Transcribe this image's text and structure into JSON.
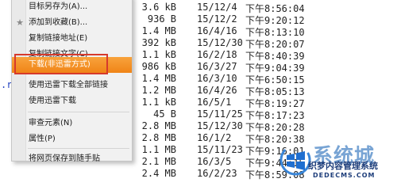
{
  "listing": {
    "rows": [
      {
        "size": "3.6 kB",
        "date": "15/12/4",
        "time": "下午8:56:04"
      },
      {
        "size": "936 B",
        "date": "15/12/2",
        "time": "下午9:20:12"
      },
      {
        "size": "1.4 MB",
        "date": "16/4/16",
        "time": "下午8:13:10"
      },
      {
        "size": "392 kB",
        "date": "15/12/30",
        "time": "下午8:20:07"
      },
      {
        "size": "1.1 kB",
        "date": "16/2/18",
        "time": "下午8:40:39"
      },
      {
        "size": "986 kB",
        "date": "16/3/27",
        "time": "下午9:04:39"
      },
      {
        "size": "1.4 MB",
        "date": "16/3/10",
        "time": "下午6:50:15"
      },
      {
        "size": "1.2 MB",
        "date": "16/4/26",
        "time": "下午8:05:13"
      },
      {
        "size": "1.1 kB",
        "date": "16/5/1",
        "time": "下午8:19:27"
      },
      {
        "size": "45 B",
        "date": "15/11/25",
        "time": "下午8:17:23"
      },
      {
        "size": "2.8 MB",
        "date": "15/12/30",
        "time": "下午8:20:28"
      },
      {
        "size": "2.8 MB",
        "date": "16/1/2",
        "time": "下午8:20:38"
      },
      {
        "size": "1.1 MB",
        "date": "15/11/23",
        "time": "下午9:16:01"
      },
      {
        "size": "2.1 MB",
        "date": "16/3/5",
        "time": "下午9:44:15"
      },
      {
        "size": "2.4 MB",
        "date": "16/2/23",
        "time": "下午8:59:08"
      }
    ],
    "stray_text": ".r"
  },
  "context_menu": {
    "items": [
      {
        "label": "目标另存为(A)...",
        "icon": ""
      },
      {
        "label": "添加到收藏(B)...",
        "icon": "star-icon"
      },
      {
        "label": "复制链接地址(E)",
        "icon": ""
      },
      {
        "label": "复制链接文字(C)",
        "icon": ""
      },
      {
        "label": "下载(非迅雷方式)",
        "icon": "",
        "active": true
      },
      {
        "label": "使用迅雷下载全部链接",
        "icon": ""
      },
      {
        "label": "使用迅雷下载",
        "icon": ""
      },
      {
        "label": "审查元素(N)",
        "icon": ""
      },
      {
        "label": "属性(P)",
        "icon": ""
      },
      {
        "label": "将网页保存到随手贴",
        "icon": ""
      }
    ],
    "active_color": "#f08417",
    "highlight_color": "#d63a2c"
  },
  "watermark": {
    "brand": "系统城",
    "name": "织梦内容管理系统",
    "url": "DEDECMS.COM",
    "ghost": "xitongcheng.com"
  }
}
